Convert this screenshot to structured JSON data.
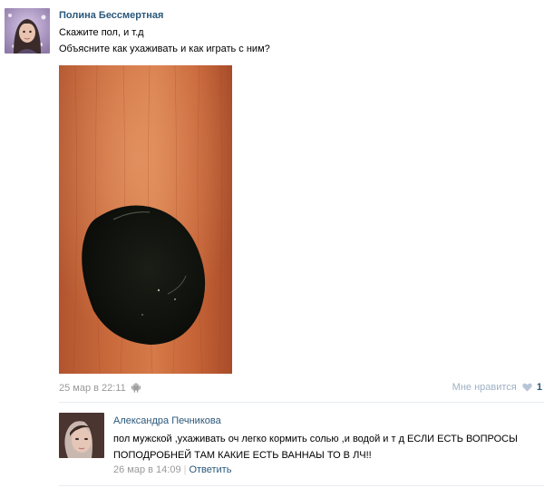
{
  "post": {
    "author": "Полина Бессмертная",
    "lines": [
      "Скажите пол, и т.д",
      "Объясните как ухаживать и как играть с ним?"
    ],
    "date": "25 мар в 22:11",
    "like_label": "Мне нравится",
    "like_count": "1"
  },
  "comment": {
    "author": "Александра Печникова",
    "text": "пол мужской ,ухаживать оч легко кормить солью ,и водой и т д ЕСЛИ ЕСТЬ ВОПРОСЫ ПОПОДРОБНЕЙ ТАМ КАКИЕ ЕСТЬ ВАННАЫ ТО В ЛЧ!!",
    "date": "26 мар в 14:09",
    "separator": "|",
    "reply_label": "Ответить"
  },
  "icons": {
    "platform": "android-icon",
    "like": "heart-icon"
  },
  "colors": {
    "link": "#2b587a",
    "muted": "#999999",
    "like_muted": "#9fb1c5",
    "divider": "#e7ebf0"
  }
}
